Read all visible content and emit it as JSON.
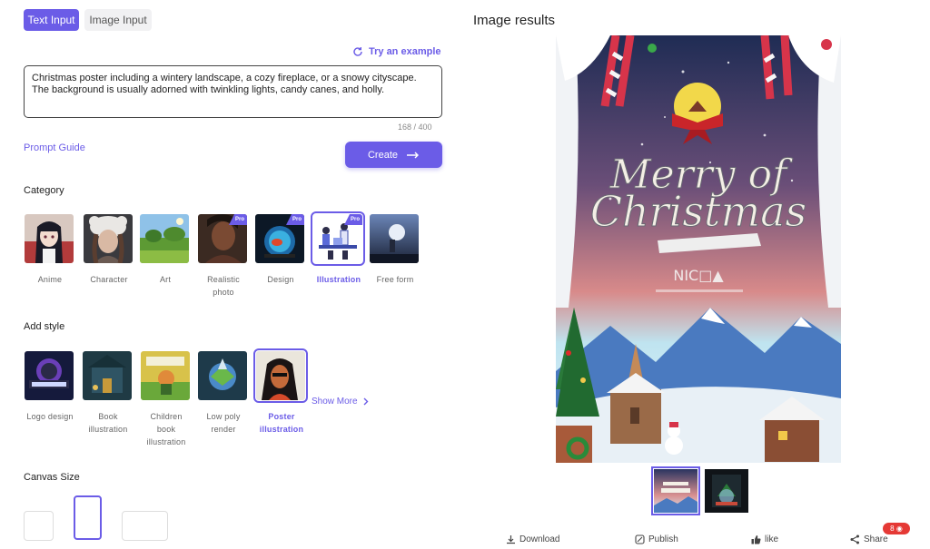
{
  "tabs": {
    "text_input": "Text Input",
    "image_input": "Image Input"
  },
  "try_example": "Try an example",
  "prompt": {
    "value": "Christmas poster including a wintery landscape, a cozy fireplace, or a snowy cityscape. The background is usually adorned with twinkling lights, candy canes, and holly.",
    "counter": "168 / 400"
  },
  "prompt_guide": "Prompt Guide",
  "create_label": "Create",
  "category": {
    "title": "Category",
    "items": [
      {
        "label": "Anime",
        "pro": false,
        "selected": false
      },
      {
        "label": "Character",
        "pro": false,
        "selected": false
      },
      {
        "label": "Art",
        "pro": false,
        "selected": false
      },
      {
        "label": "Realistic photo",
        "pro": true,
        "selected": false
      },
      {
        "label": "Design",
        "pro": true,
        "selected": false
      },
      {
        "label": "Illustration",
        "pro": true,
        "selected": true
      },
      {
        "label": "Free form",
        "pro": false,
        "selected": false
      }
    ],
    "pro_label": "Pro"
  },
  "style": {
    "title": "Add style",
    "items": [
      {
        "label": "Logo design",
        "selected": false
      },
      {
        "label": "Book illustration",
        "selected": false
      },
      {
        "label": "Children book illustration",
        "selected": false
      },
      {
        "label": "Low poly render",
        "selected": false
      },
      {
        "label": "Poster illustration",
        "selected": true
      }
    ],
    "show_more": "Show More"
  },
  "canvas": {
    "title": "Canvas Size",
    "selected": "portrait"
  },
  "results": {
    "title": "Image results",
    "poster_text": {
      "headline_1": "Merry of",
      "headline_2": "Christmas",
      "sub": "NIC□▲"
    }
  },
  "actions": {
    "download": "Download",
    "publish": "Publish",
    "like": "like",
    "share": "Share",
    "share_badge": "8 ◉"
  },
  "colors": {
    "accent": "#6b5ce7",
    "badge": "#e53935"
  }
}
